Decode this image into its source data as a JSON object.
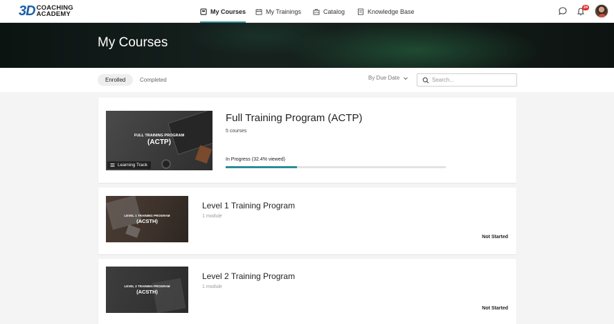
{
  "nav": {
    "logo_mark": "3D",
    "logo_line1": "COACHING",
    "logo_line2": "ACADEMY",
    "items": [
      {
        "label": "My Courses",
        "icon": "book-icon",
        "active": true
      },
      {
        "label": "My Trainings",
        "icon": "calendar-icon",
        "active": false
      },
      {
        "label": "Catalog",
        "icon": "briefcase-icon",
        "active": false
      },
      {
        "label": "Knowledge Base",
        "icon": "document-icon",
        "active": false
      }
    ],
    "notification_count": "24"
  },
  "hero": {
    "title": "My Courses"
  },
  "filters": {
    "tabs": [
      {
        "label": "Enrolled",
        "active": true
      },
      {
        "label": "Completed",
        "active": false
      }
    ],
    "sort_label": "By Due Date",
    "search_placeholder": "Search..."
  },
  "courses": [
    {
      "title": "Full Training Program (ACTP)",
      "subtitle": "5 courses",
      "thumb_line1": "FULL TRAINING PROGRAM",
      "thumb_line2": "(ACTP)",
      "tag": "Learning Track",
      "status": "In Progress (32.4% viewed)",
      "progress": 0.324
    },
    {
      "title": "Level 1 Training Program",
      "subtitle": "1 module",
      "thumb_line1": "LEVEL 1 TRAINING PROGRAM",
      "thumb_line2": "(ACSTH)",
      "status": "Not Started"
    },
    {
      "title": "Level 2 Training Program",
      "subtitle": "1 module",
      "thumb_line1": "LEVEL 2 TRAINING PROGRAM",
      "thumb_line2": "(ACSTH)",
      "status": "Not Started"
    }
  ],
  "colors": {
    "accent": "#2b8b95",
    "badge": "#e02b2b",
    "logo_blue": "#1d5fa8"
  }
}
